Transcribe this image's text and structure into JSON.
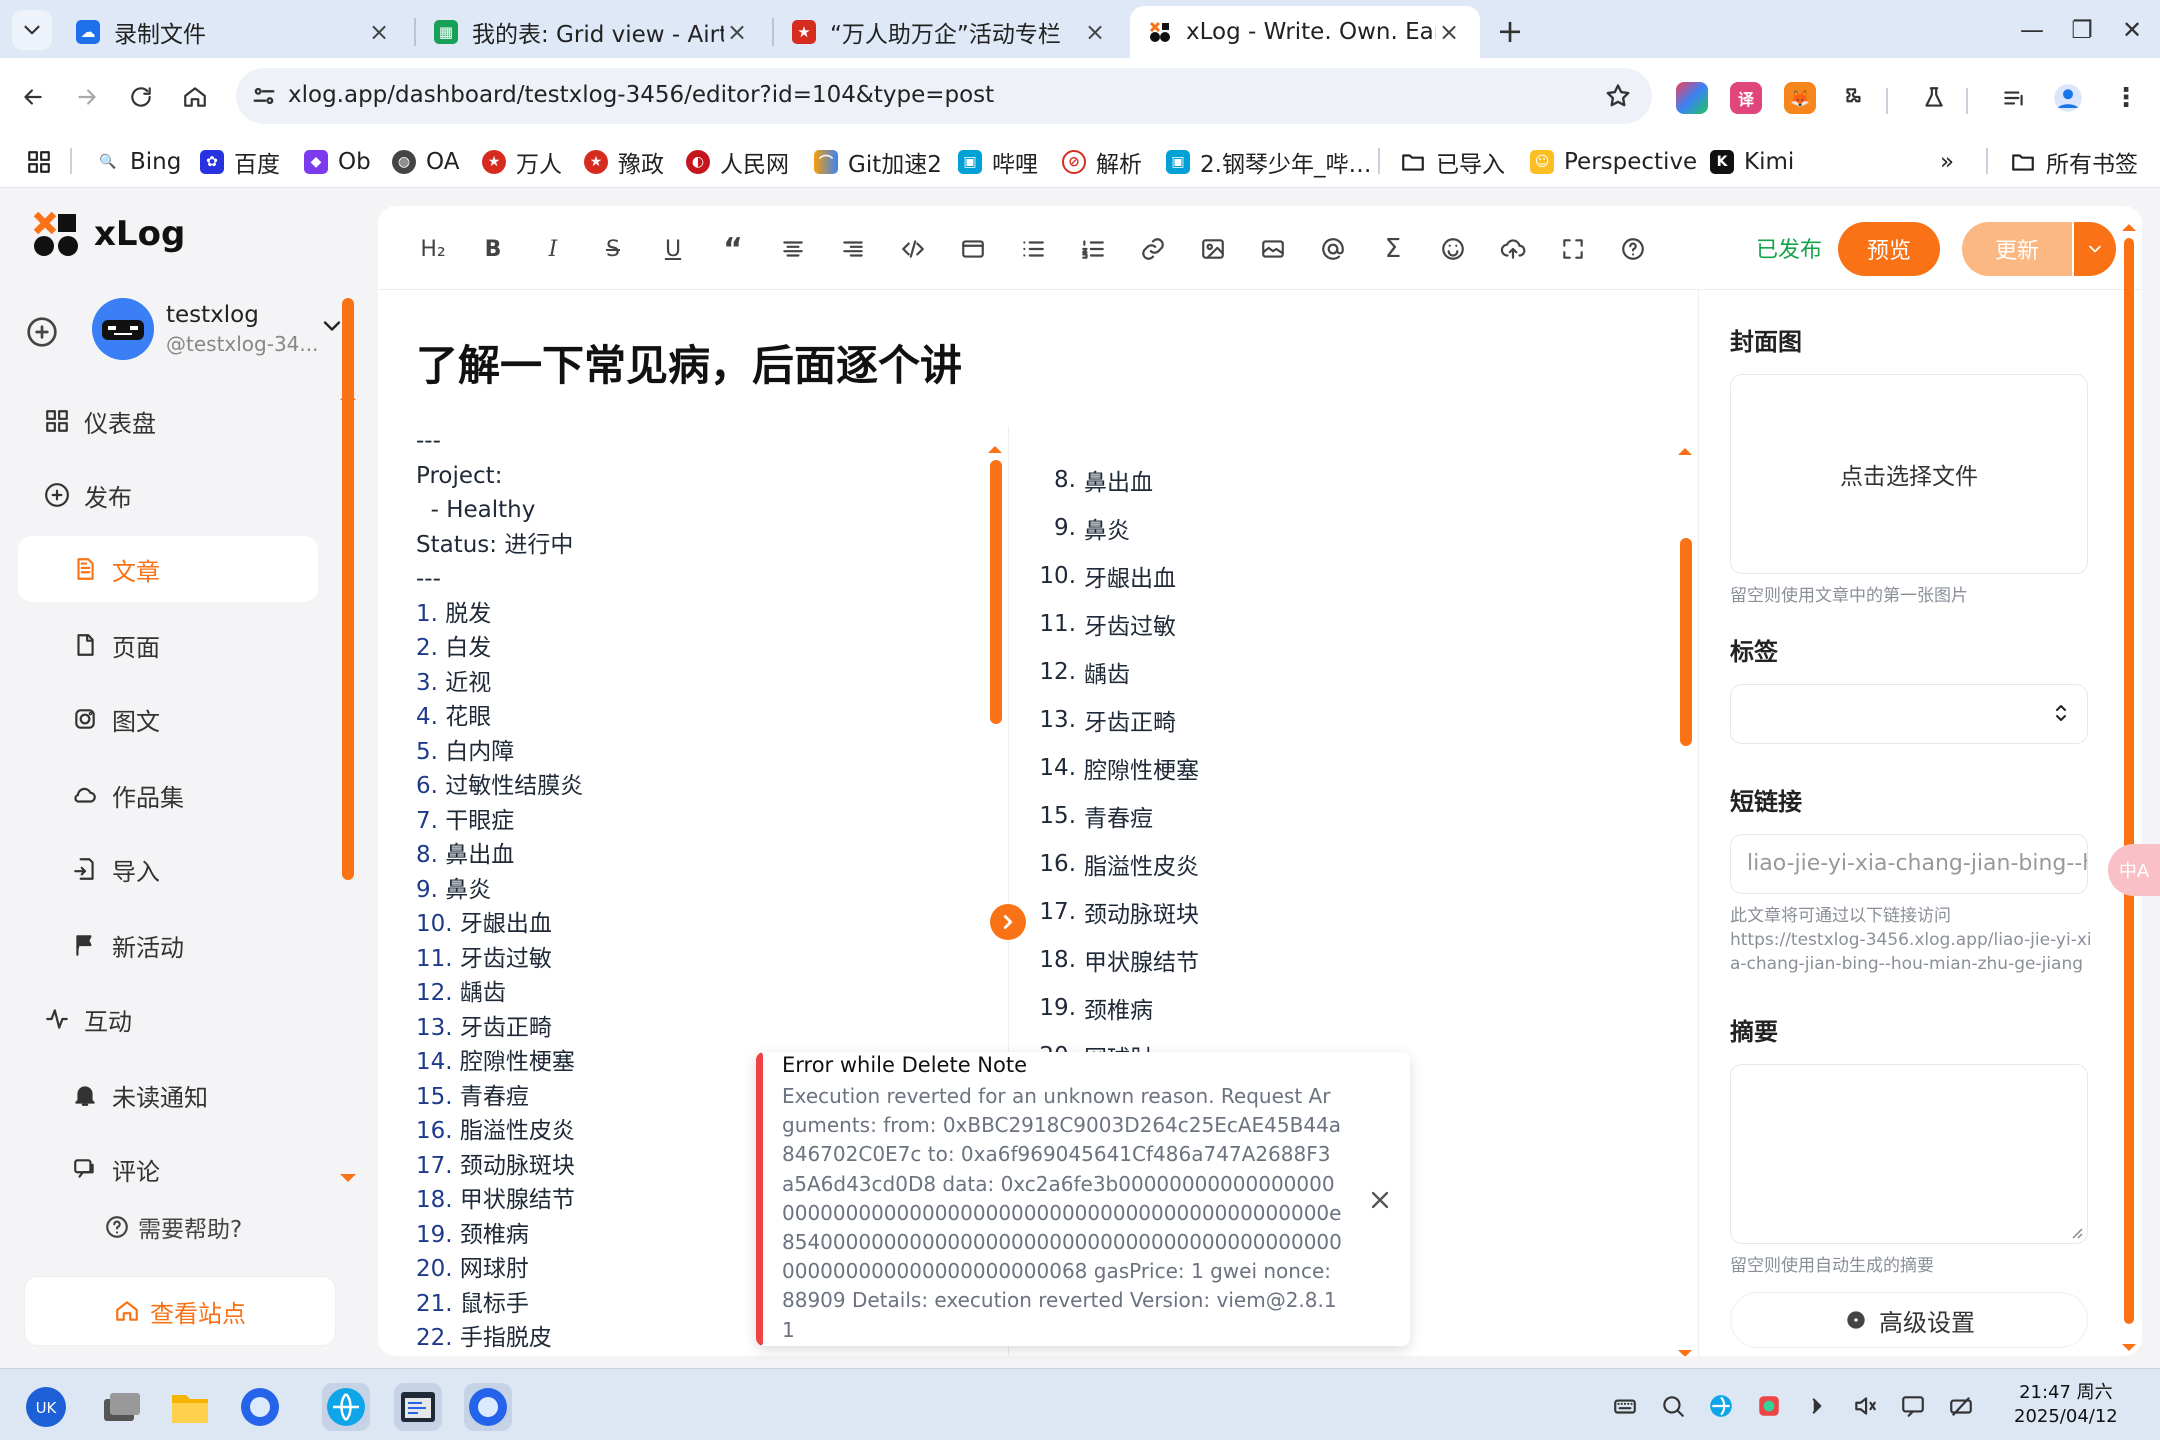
{
  "browser": {
    "tabs": [
      {
        "title": "录制文件",
        "active": false
      },
      {
        "title": "我的表: Grid view - Airtable",
        "active": false
      },
      {
        "title": "“万人助万企”活动专栏",
        "active": false
      },
      {
        "title": "xLog - Write. Own. Earn.",
        "active": true
      }
    ],
    "url": "xlog.app/dashboard/testxlog-3456/editor?id=104&type=post",
    "bookmarks": [
      "Bing",
      "百度",
      "Ob",
      "OA",
      "万人",
      "豫政",
      "人民网",
      "Git加速2",
      "哔哩",
      "解析",
      "2.钢琴少年_哔…",
      "已导入",
      "Perspective",
      "Kimi"
    ],
    "bookmarks_more": "»",
    "all_bookmarks": "所有书签"
  },
  "sidebar": {
    "logo_text": "xLog",
    "user": {
      "name": "testxlog",
      "handle": "@testxlog-34..."
    },
    "nav": [
      {
        "label": "仪表盘",
        "icon": "dashboard-icon",
        "active": false
      },
      {
        "label": "发布",
        "icon": "plus-circle-icon",
        "active": false
      },
      {
        "label": "文章",
        "icon": "article-icon",
        "active": true
      },
      {
        "label": "页面",
        "icon": "page-icon",
        "active": false
      },
      {
        "label": "图文",
        "icon": "instagram-icon",
        "active": false
      },
      {
        "label": "作品集",
        "icon": "cloud-icon",
        "active": false
      },
      {
        "label": "导入",
        "icon": "import-icon",
        "active": false
      },
      {
        "label": "新活动",
        "icon": "flag-icon",
        "active": false
      },
      {
        "label": "互动",
        "icon": "activity-icon",
        "active": false
      },
      {
        "label": "未读通知",
        "icon": "bell-icon",
        "active": false
      },
      {
        "label": "评论",
        "icon": "comment-icon",
        "active": false
      }
    ],
    "help": "需要帮助?",
    "view_site": "查看站点"
  },
  "editor": {
    "status": "已发布",
    "preview_label": "预览",
    "update_label": "更新",
    "title": "了解一下常见病，后面逐个讲",
    "frontmatter": [
      "---",
      "Project:",
      "  - Healthy",
      "Status: 进行中",
      "---"
    ],
    "source_list": [
      {
        "n": "1.",
        "t": "脱发"
      },
      {
        "n": "2.",
        "t": "白发"
      },
      {
        "n": "3.",
        "t": "近视"
      },
      {
        "n": "4.",
        "t": "花眼"
      },
      {
        "n": "5.",
        "t": "白内障"
      },
      {
        "n": "6.",
        "t": "过敏性结膜炎"
      },
      {
        "n": "7.",
        "t": "干眼症"
      },
      {
        "n": "8.",
        "t": "鼻出血"
      },
      {
        "n": "9.",
        "t": "鼻炎"
      },
      {
        "n": "10.",
        "t": "牙龈出血"
      },
      {
        "n": "11.",
        "t": "牙齿过敏"
      },
      {
        "n": "12.",
        "t": "龋齿"
      },
      {
        "n": "13.",
        "t": "牙齿正畸"
      },
      {
        "n": "14.",
        "t": "腔隙性梗塞"
      },
      {
        "n": "15.",
        "t": "青春痘"
      },
      {
        "n": "16.",
        "t": "脂溢性皮炎"
      },
      {
        "n": "17.",
        "t": "颈动脉斑块"
      },
      {
        "n": "18.",
        "t": "甲状腺结节"
      },
      {
        "n": "19.",
        "t": "颈椎病"
      },
      {
        "n": "20.",
        "t": "网球肘"
      },
      {
        "n": "21.",
        "t": "鼠标手"
      },
      {
        "n": "22.",
        "t": "手指脱皮"
      }
    ],
    "preview_list": [
      {
        "n": "8.",
        "t": "鼻出血"
      },
      {
        "n": "9.",
        "t": "鼻炎"
      },
      {
        "n": "10.",
        "t": "牙龈出血"
      },
      {
        "n": "11.",
        "t": "牙齿过敏"
      },
      {
        "n": "12.",
        "t": "龋齿"
      },
      {
        "n": "13.",
        "t": "牙齿正畸"
      },
      {
        "n": "14.",
        "t": "腔隙性梗塞"
      },
      {
        "n": "15.",
        "t": "青春痘"
      },
      {
        "n": "16.",
        "t": "脂溢性皮炎"
      },
      {
        "n": "17.",
        "t": "颈动脉斑块"
      },
      {
        "n": "18.",
        "t": "甲状腺结节"
      },
      {
        "n": "19.",
        "t": "颈椎病"
      },
      {
        "n": "20.",
        "t": "网球肘"
      }
    ]
  },
  "settings": {
    "cover_label": "封面图",
    "cover_button": "点击选择文件",
    "cover_hint": "留空则使用文章中的第一张图片",
    "tags_label": "标签",
    "slug_label": "短链接",
    "slug_placeholder": "liao-jie-yi-xia-chang-jian-bing--hou-mian-zhu-ge-jiang",
    "slug_hint": "此文章将可通过以下链接访问",
    "slug_url": "https://testxlog-3456.xlog.app/liao-jie-yi-xia-chang-jian-bing--hou-mian-zhu-ge-jiang",
    "summary_label": "摘要",
    "summary_hint": "留空则使用自动生成的摘要",
    "advanced": "高级设置"
  },
  "toast": {
    "title": "Error while Delete Note",
    "body": "Execution reverted for an unknown reason. Request Arguments: from: 0xBBC2918C9003D264c25EcAE45B44a846702C0E7c to: 0xa6f969045641Cf486a747A2688F3a5A6d43cd0D8 data: 0xc2a6fe3b000000000000000000000000000000000000000000000000000000000000e85400000000000000000000000000000000000000000000000000000000000000068 gasPrice: 1 gwei nonce: 88909 Details: execution reverted Version: viem@2.8.11"
  },
  "taskbar": {
    "time": "21:47 周六",
    "date": "2025/04/12"
  },
  "colors": {
    "accent": "#f97316",
    "published": "#16a34a",
    "error": "#ef4444"
  }
}
